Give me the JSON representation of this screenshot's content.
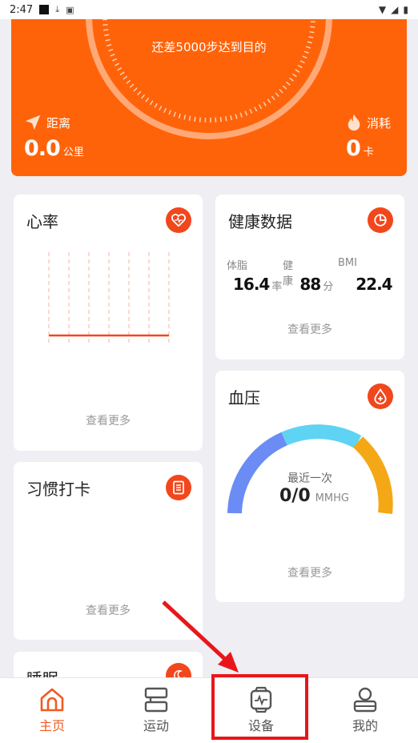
{
  "status_bar": {
    "time": "2:47"
  },
  "steps": {
    "remaining_text": "还差5000步达到目的",
    "distance": {
      "label": "距离",
      "value": "0.0",
      "unit": "公里"
    },
    "calorie": {
      "label": "消耗",
      "value": "0",
      "unit": "卡"
    }
  },
  "heart_rate": {
    "title": "心率",
    "more": "查看更多"
  },
  "health_data": {
    "title": "健康数据",
    "labels": {
      "body_fat": "体脂",
      "health": "健康",
      "bmi": "BMI"
    },
    "body_fat_value": "16.4",
    "body_fat_unit": "率",
    "health_value": "88",
    "health_unit": "分",
    "bmi_value": "22.4",
    "more": "查看更多"
  },
  "blood_pressure": {
    "title": "血压",
    "last_label": "最近一次",
    "value": "0/0",
    "unit": "MMHG",
    "more": "查看更多"
  },
  "habit": {
    "title": "习惯打卡",
    "more": "查看更多"
  },
  "sleep": {
    "title": "睡眠"
  },
  "tabs": [
    {
      "label": "主页",
      "active": true
    },
    {
      "label": "运动",
      "active": false
    },
    {
      "label": "设备",
      "active": false
    },
    {
      "label": "我的",
      "active": false
    }
  ],
  "colors": {
    "accent": "#ff6309",
    "icon_red": "#f1471d",
    "highlight": "#e8161b"
  }
}
